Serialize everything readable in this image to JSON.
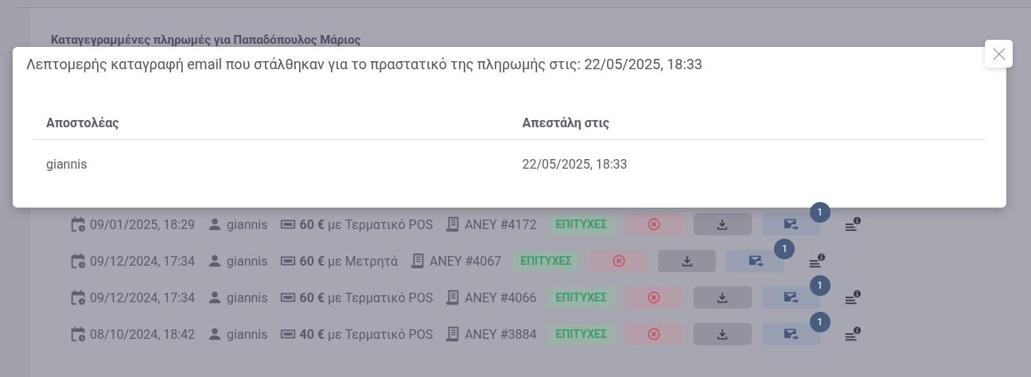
{
  "background": {
    "heading": "Καταγεγραμμένες πληρωμές για Παπαδόπουλος Μάριος"
  },
  "payments": [
    {
      "date": "09/01/2025, 18:29",
      "user": "giannis",
      "amount": "**60 €** με Τερματικό POS",
      "receipt": "ΑΝΕΥ #4172",
      "status": "ΕΠΙΤΥΧΕΣ",
      "email_count": "1"
    },
    {
      "date": "09/12/2024, 17:34",
      "user": "giannis",
      "amount": "**60 €** με Μετρητά",
      "receipt": "ΑΝΕΥ #4067",
      "status": "ΕΠΙΤΥΧΕΣ",
      "email_count": "1"
    },
    {
      "date": "09/12/2024, 17:34",
      "user": "giannis",
      "amount": "**60 €** με Τερματικό POS",
      "receipt": "ΑΝΕΥ #4066",
      "status": "ΕΠΙΤΥΧΕΣ",
      "email_count": "1"
    },
    {
      "date": "08/10/2024, 18:42",
      "user": "giannis",
      "amount": "**40 €** με Τερματικό POS",
      "receipt": "ΑΝΕΥ #3884",
      "status": "ΕΠΙΤΥΧΕΣ",
      "email_count": "1"
    }
  ],
  "modal": {
    "title": "Λεπτομερής καταγραφή email που στάλθηκαν για το πραστατικό της πληρωμής στις: 22/05/2025, 18:33",
    "table": {
      "columns": [
        "Αποστολέας",
        "Απεστάλη στις"
      ],
      "rows": [
        [
          "giannis",
          "22/05/2025, 18:33"
        ]
      ]
    }
  }
}
